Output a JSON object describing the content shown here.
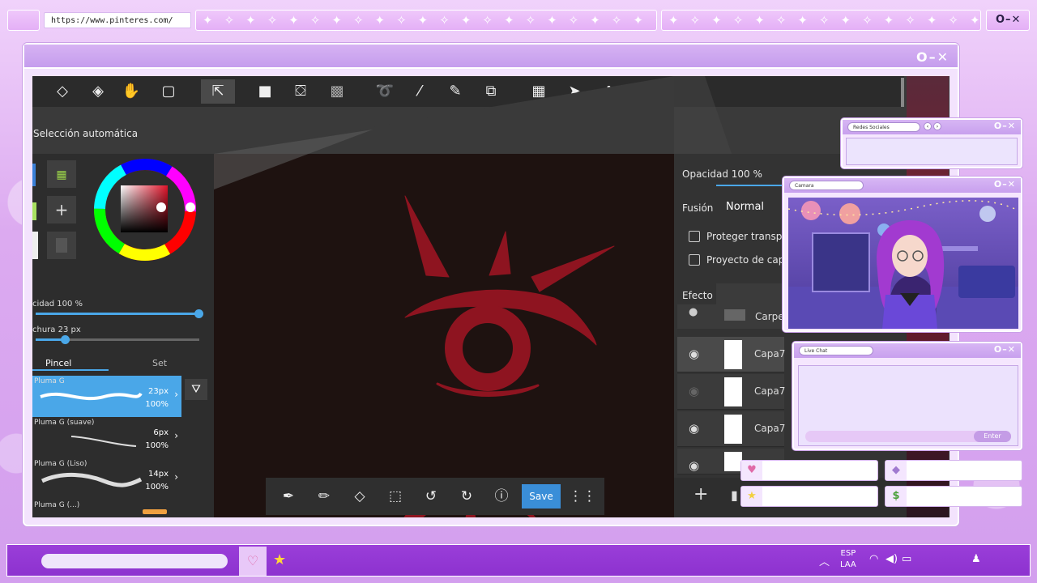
{
  "browser": {
    "url": "https://www.pinteres.com/",
    "window_controls": "O–✕"
  },
  "main_window": {
    "controls": "O–✕"
  },
  "app": {
    "mode_label": "Selección automática",
    "brush_panel": {
      "opacity_label": "cidad  100  %",
      "width_label": "chura  23  px",
      "tab_brush": "Pincel",
      "tab_set": "Set",
      "brushes": [
        {
          "name": "Pluma G",
          "size": "23px",
          "opacity": "100%"
        },
        {
          "name": "Pluma G (suave)",
          "size": "6px",
          "opacity": "100%"
        },
        {
          "name": "Pluma G (Liso)",
          "size": "14px",
          "opacity": "100%"
        },
        {
          "name": "Pluma G (...)",
          "size": "",
          "opacity": ""
        }
      ],
      "brush_opacity_fraction": 1.0,
      "brush_width_fraction": 0.2
    },
    "layers_panel": {
      "opacity_label": "Opacidad  100  %",
      "blend_label": "Fusión",
      "blend_value": "Normal",
      "protect_label": "Proteger transpa",
      "clip_label": "Proyecto de cap",
      "effect_label": "Efecto",
      "folder_label": "Carpet",
      "layers": [
        {
          "name": "Capa7"
        },
        {
          "name": "Capa7"
        },
        {
          "name": "Capa7"
        }
      ]
    },
    "bottom_toolbar": {
      "save_label": "Save"
    },
    "colors": {
      "stroke_red": "#8e1420",
      "canvas_bg": "#1e1210",
      "accent_blue": "#4aa7e8"
    }
  },
  "overlay": {
    "social_window": {
      "title": "Redes Sociales",
      "controls": "O–✕"
    },
    "camera_window": {
      "title": "Camara",
      "controls": "O–✕"
    },
    "chat_window": {
      "title": "Live Chat",
      "controls": "O–✕",
      "enter_label": "Enter"
    }
  },
  "taskbar": {
    "language_line1": "ESP",
    "language_line2": "LAA"
  },
  "theme": {
    "frame_purple": "#c59ded",
    "taskbar_purple": "#9a3ed9"
  }
}
